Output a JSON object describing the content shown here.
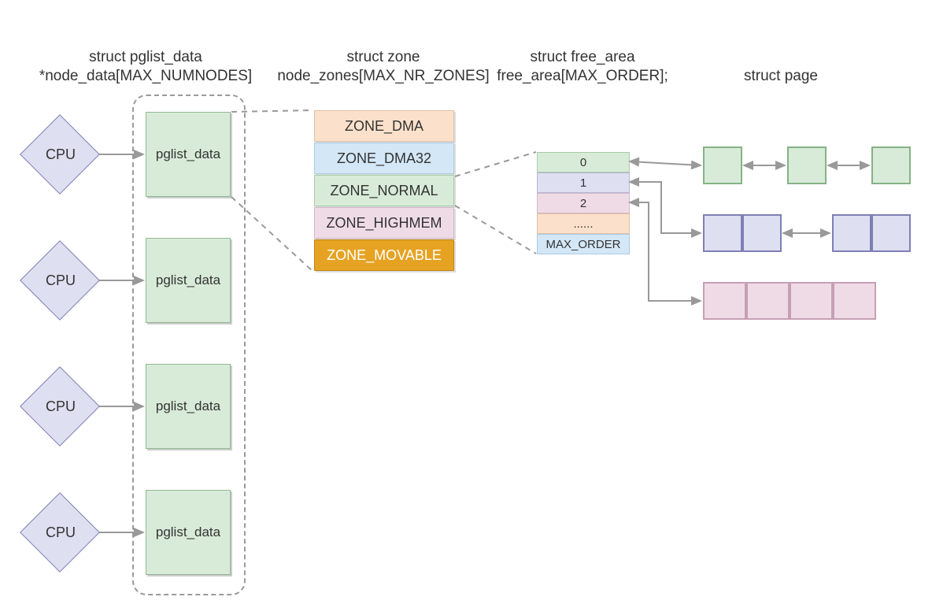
{
  "columns": {
    "pglist": {
      "line1": "struct pglist_data",
      "line2": "*node_data[MAX_NUMNODES]"
    },
    "zone": {
      "line1": "struct zone",
      "line2": "node_zones[MAX_NR_ZONES]"
    },
    "free": {
      "line1": "struct free_area",
      "line2": "free_area[MAX_ORDER];"
    },
    "page": {
      "line1": "struct page"
    }
  },
  "cpu_label": "CPU",
  "pglist_label": "pglist_data",
  "zones": {
    "dma": "ZONE_DMA",
    "dma32": "ZONE_DMA32",
    "normal": "ZONE_NORMAL",
    "highmem": "ZONE_HIGHMEM",
    "movable": "ZONE_MOVABLE"
  },
  "free_area": {
    "r0": "0",
    "r1": "1",
    "r2": "2",
    "r3": "......",
    "r4": "MAX_ORDER"
  },
  "colors": {
    "green": "#d8ebd8",
    "violet": "#dedff0",
    "pink": "#efdbe6",
    "peach": "#fbe1cb",
    "blue": "#d3e7f6",
    "orange": "#e6a323"
  }
}
